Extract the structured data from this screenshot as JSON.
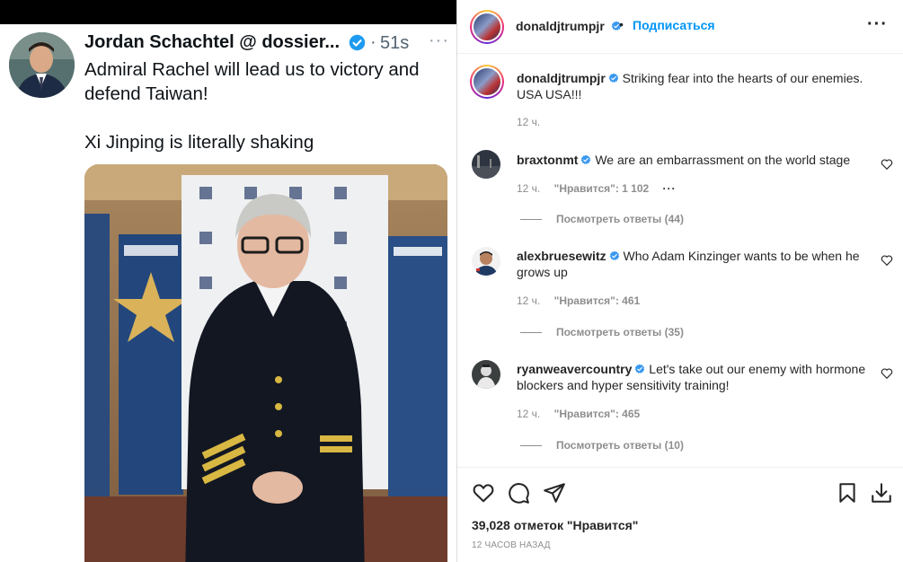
{
  "tweet": {
    "author": "Jordan Schachtel @ dossier...",
    "time": "51s",
    "separator": "·",
    "more": "···",
    "lines": [
      "Admiral Rachel will lead us to victory and defend Taiwan!",
      "Xi Jinping is literally shaking"
    ]
  },
  "instagram": {
    "header": {
      "username": "donaldjtrumpjr",
      "separator": "•",
      "follow_label": "Подписаться",
      "more": "···"
    },
    "caption": {
      "username": "donaldjtrumpjr",
      "text": "Striking fear into the hearts of our enemies. USA USA!!!",
      "time": "12 ч."
    },
    "comments": [
      {
        "username": "braxtonmt",
        "text": "We are an embarrassment on the world stage",
        "time": "12 ч.",
        "likes": "\"Нравится\": 1 102",
        "options": "···",
        "replies": "Посмотреть ответы (44)"
      },
      {
        "username": "alexbruesewitz",
        "text": "Who Adam Kinzinger wants to be when he grows up",
        "time": "12 ч.",
        "likes": "\"Нравится\": 461",
        "replies": "Посмотреть ответы (35)"
      },
      {
        "username": "ryanweavercountry",
        "text": "Let's take out our enemy with hormone blockers and hyper sensitivity training!",
        "time": "12 ч.",
        "likes": "\"Нравится\": 465",
        "replies": "Посмотреть ответы (10)"
      }
    ],
    "likes_total": "39,028 отметок \"Нравится\"",
    "posted": "12 ЧАСОВ НАЗАД"
  },
  "colors": {
    "twitter_verified": "#1d9bf0",
    "instagram_blue": "#0095f6",
    "instagram_verified": "#3897f0",
    "text_secondary": "#8e8e8e"
  }
}
